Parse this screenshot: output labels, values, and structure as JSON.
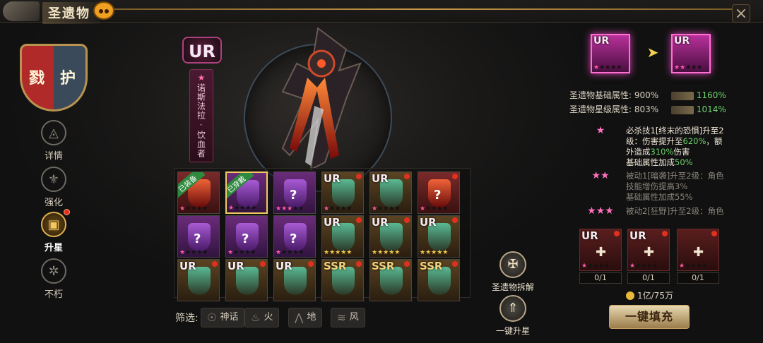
{
  "header": {
    "title": "圣遗物",
    "close_icon": "×"
  },
  "shield": {
    "left_char": "戮",
    "right_char": "护"
  },
  "nav": [
    {
      "label": "详情",
      "icon": "◬",
      "active": false,
      "dot": false
    },
    {
      "label": "强化",
      "icon": "⚜",
      "active": false,
      "dot": false
    },
    {
      "label": "升星",
      "icon": "▣",
      "active": true,
      "dot": true
    },
    {
      "label": "不朽",
      "icon": "✲",
      "active": false,
      "dot": false
    }
  ],
  "relic": {
    "rank": "UR",
    "name": "诺斯法拉·饮血者",
    "star": "★"
  },
  "grid": [
    {
      "rank": "",
      "tag": "已装备",
      "tag_style": "g",
      "bg": "red",
      "q": "",
      "stars": 1,
      "gold": false,
      "dot": false,
      "sel": false
    },
    {
      "rank": "",
      "tag": "已穿戴",
      "tag_style": "g",
      "bg": "purple",
      "q": "",
      "stars": 1,
      "gold": false,
      "dot": false,
      "sel": true
    },
    {
      "rank": "",
      "tag": "",
      "bg": "purple",
      "q": "?",
      "stars": 3,
      "gold": false,
      "dot": false,
      "sel": false
    },
    {
      "rank": "UR",
      "tag": "",
      "bg": "gold",
      "q": "",
      "stars": 1,
      "gold": false,
      "dot": true,
      "sel": false
    },
    {
      "rank": "UR",
      "tag": "",
      "bg": "gold",
      "q": "",
      "stars": 1,
      "gold": false,
      "dot": true,
      "sel": false
    },
    {
      "rank": "",
      "tag": "",
      "bg": "red",
      "q": "?",
      "stars": 1,
      "gold": false,
      "dot": true,
      "sel": false
    },
    {
      "rank": "",
      "tag": "",
      "bg": "purple",
      "q": "?",
      "stars": 1,
      "gold": false,
      "dot": false,
      "sel": false
    },
    {
      "rank": "",
      "tag": "",
      "bg": "purple",
      "q": "?",
      "stars": 1,
      "gold": false,
      "dot": false,
      "sel": false
    },
    {
      "rank": "",
      "tag": "",
      "bg": "purple",
      "q": "?",
      "stars": 1,
      "gold": false,
      "dot": false,
      "sel": false
    },
    {
      "rank": "UR",
      "tag": "",
      "bg": "gold",
      "q": "",
      "stars": 5,
      "gold": true,
      "dot": true,
      "sel": false
    },
    {
      "rank": "UR",
      "tag": "",
      "bg": "gold",
      "q": "",
      "stars": 5,
      "gold": true,
      "dot": true,
      "sel": false
    },
    {
      "rank": "UR",
      "tag": "",
      "bg": "gold",
      "q": "",
      "stars": 5,
      "gold": true,
      "dot": true,
      "sel": false
    },
    {
      "rank": "UR",
      "tag": "",
      "bg": "gold",
      "q": "",
      "stars": 0,
      "gold": false,
      "dot": true,
      "sel": false
    },
    {
      "rank": "UR",
      "tag": "",
      "bg": "gold",
      "q": "",
      "stars": 0,
      "gold": false,
      "dot": true,
      "sel": false
    },
    {
      "rank": "UR",
      "tag": "",
      "bg": "gold",
      "q": "",
      "stars": 0,
      "gold": false,
      "dot": true,
      "sel": false
    },
    {
      "rank": "SSR",
      "tag": "",
      "bg": "gold",
      "q": "",
      "stars": 0,
      "gold": false,
      "dot": true,
      "sel": false
    },
    {
      "rank": "SSR",
      "tag": "",
      "bg": "gold",
      "q": "",
      "stars": 0,
      "gold": false,
      "dot": true,
      "sel": false
    },
    {
      "rank": "SSR",
      "tag": "",
      "bg": "gold",
      "q": "",
      "stars": 0,
      "gold": false,
      "dot": true,
      "sel": false
    }
  ],
  "filter": {
    "label": "筛选:",
    "buttons": [
      {
        "label": "神话",
        "icon": "☉"
      },
      {
        "label": "火",
        "icon": "♨"
      },
      {
        "label": "地",
        "icon": "⋀"
      },
      {
        "label": "风",
        "icon": "≋"
      }
    ]
  },
  "actions": {
    "dismantle": "圣遗物拆解",
    "upgrade": "一键升星"
  },
  "upgrade": {
    "from_rank": "UR",
    "to_rank": "UR",
    "from_stars": 1,
    "to_stars": 2,
    "stats": [
      {
        "label": "圣遗物基础属性:",
        "value": "900%",
        "next": "1160%"
      },
      {
        "label": "圣遗物星级属性:",
        "value": "803%",
        "next": "1014%"
      }
    ],
    "skills": [
      {
        "stars": "★",
        "dim": false,
        "l1": "必杀技1[终末的恐惧]升至2",
        "l2a": "级：伤害提升至",
        "l2g": "620%",
        "l2b": "，额",
        "l3a": "外造成",
        "l3g": "310%",
        "l3b": "伤害",
        "l4a": "基础属性加成",
        "l4g": "50%"
      },
      {
        "stars": "★★",
        "dim": true,
        "l1": "被动1[暗袭]升至2级：角色",
        "l2": "技能增伤提高3%",
        "l3": "基础属性加成55%"
      },
      {
        "stars": "★★★",
        "dim": true,
        "l1": "被动2[狂野]升至2级：角色"
      }
    ],
    "materials": [
      {
        "rank": "UR",
        "count": "0/1"
      },
      {
        "rank": "UR",
        "count": "0/1"
      },
      {
        "rank": "",
        "count": "0/1"
      }
    ],
    "coin": "1亿/75万",
    "fill_button": "一键填充"
  },
  "colors": {
    "accent_gold": "#f2c860",
    "ur_pink": "#ff70d0",
    "green_up": "#6bd36b"
  }
}
